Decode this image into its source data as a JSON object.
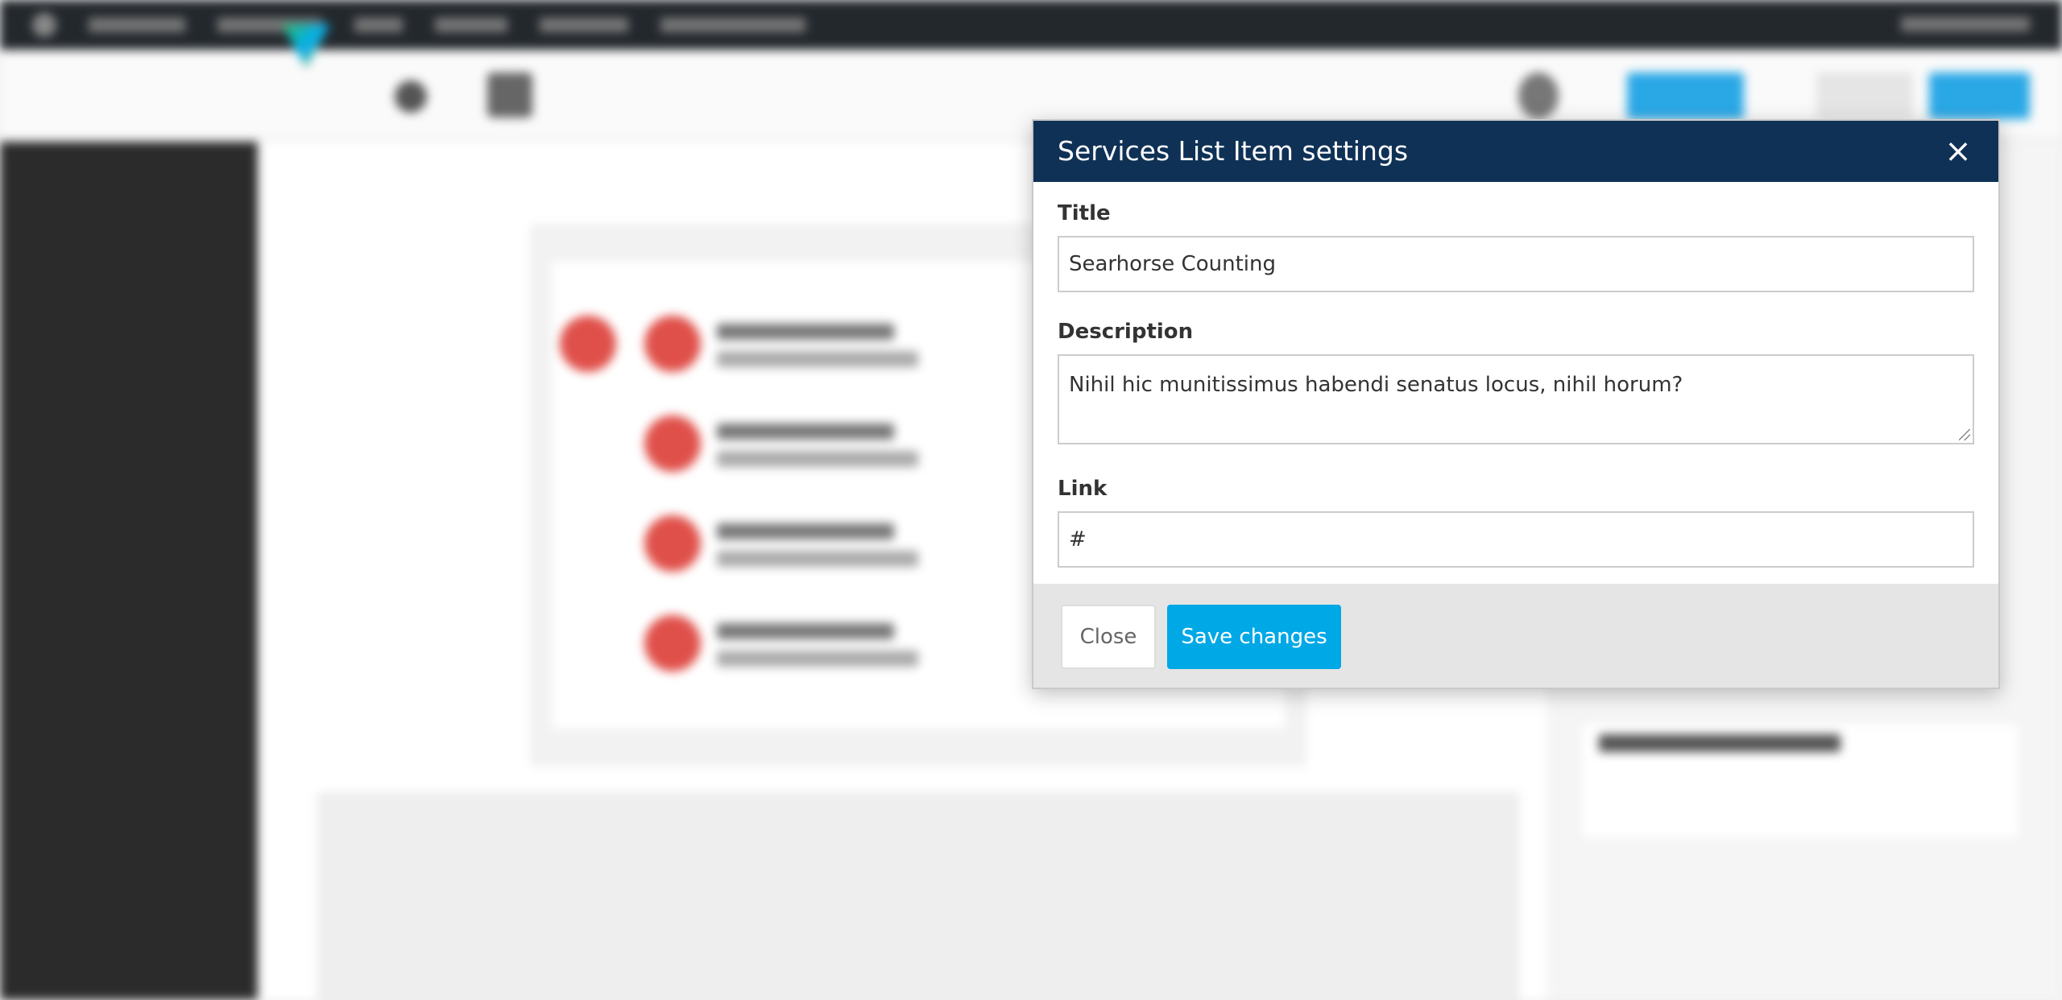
{
  "modal": {
    "title": "Services List Item settings",
    "close_icon": "×",
    "fields": {
      "title_label": "Title",
      "title_value": "Searhorse Counting",
      "description_label": "Description",
      "description_value": "Nihil hic munitissimus habendi senatus locus, nihil horum?",
      "link_label": "Link",
      "link_value": "#"
    },
    "footer": {
      "close_label": "Close",
      "save_label": "Save changes"
    }
  },
  "colors": {
    "modal_header": "#0f3156",
    "save_button": "#00a8e6",
    "admin_bar": "#23282d",
    "accent_dot": "#e0504a"
  }
}
